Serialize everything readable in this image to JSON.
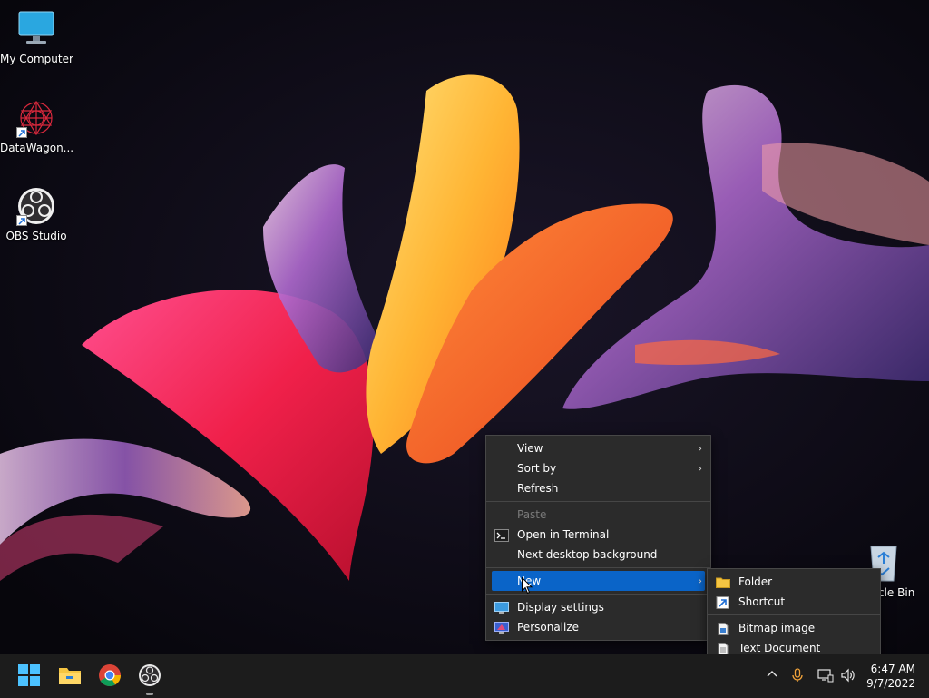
{
  "desktop": {
    "icons": [
      {
        "label": "My Computer"
      },
      {
        "label": "DataWagon..."
      },
      {
        "label": "OBS Studio"
      },
      {
        "label": "Recycle Bin",
        "visible_label": "cle Bin"
      }
    ]
  },
  "context_menu": {
    "items": {
      "view": "View",
      "sort_by": "Sort by",
      "refresh": "Refresh",
      "paste": "Paste",
      "open_terminal": "Open in Terminal",
      "next_background": "Next desktop background",
      "new": "New",
      "display_settings": "Display settings",
      "personalize": "Personalize"
    },
    "submenu_arrow": "›",
    "highlight_color": "#0a64c8"
  },
  "new_submenu": {
    "items": {
      "folder": "Folder",
      "shortcut": "Shortcut",
      "bitmap": "Bitmap image",
      "text_document": "Text Document"
    }
  },
  "taskbar": {
    "apps": [
      "start-icon",
      "file-explorer-icon",
      "chrome-icon",
      "obs-icon"
    ],
    "tray": {
      "chevron": "^",
      "mic": "🎙",
      "speaker": "🔊"
    },
    "clock": {
      "time": "6:47 AM",
      "date": "9/7/2022"
    }
  }
}
